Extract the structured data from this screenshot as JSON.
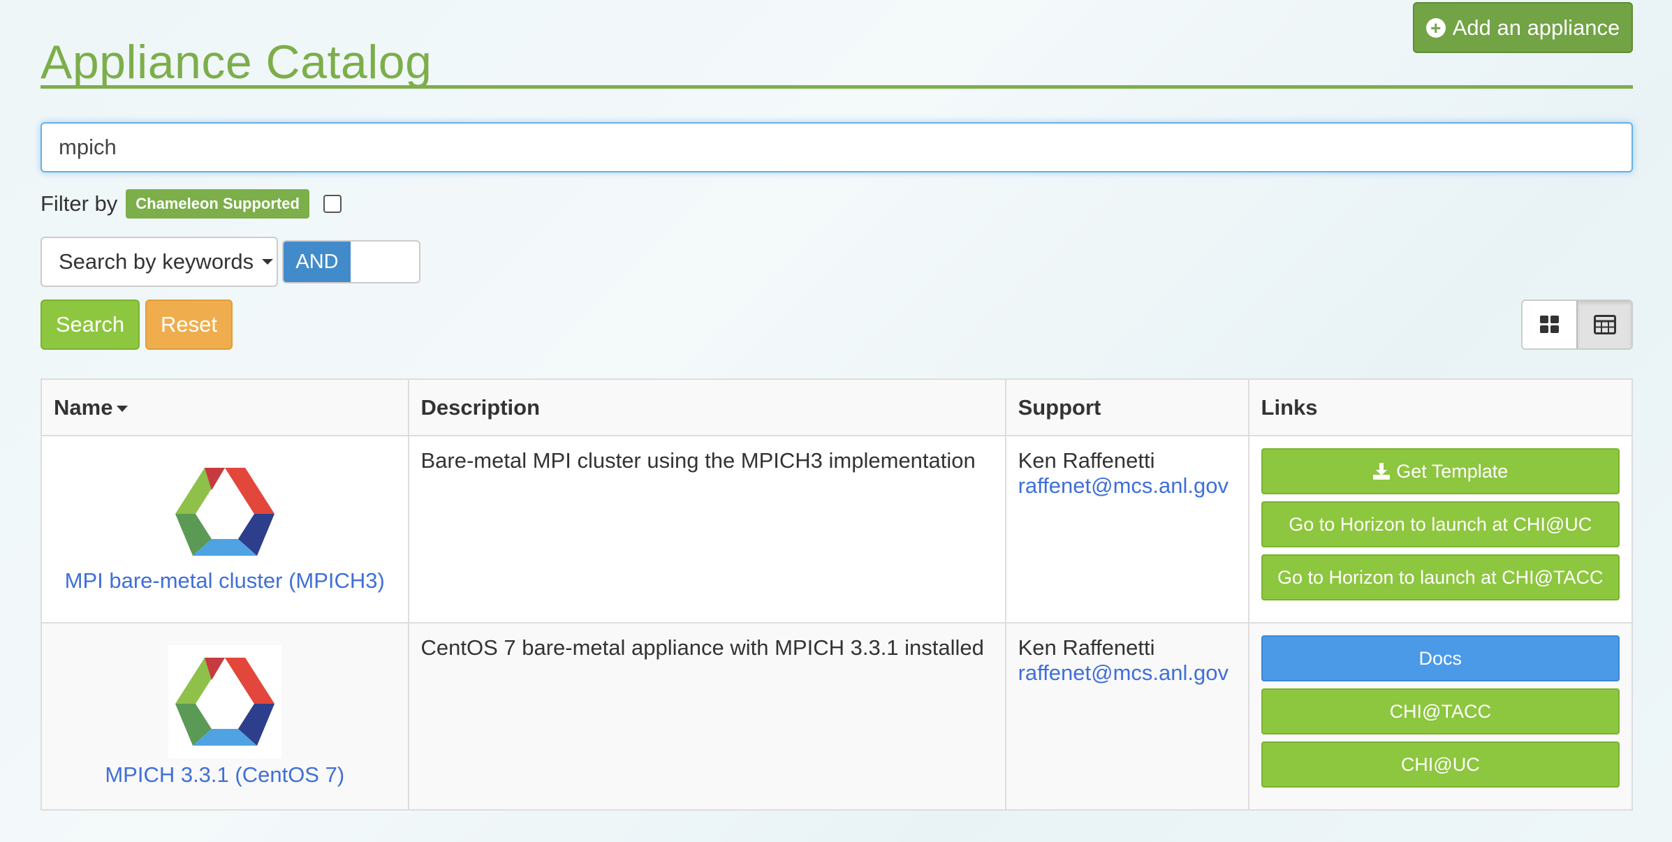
{
  "header": {
    "add_button_label": "Add an appliance",
    "title": "Appliance Catalog"
  },
  "search": {
    "value": "mpich"
  },
  "filter": {
    "label": "Filter by",
    "badge": "Chameleon Supported",
    "checked": false
  },
  "keywords": {
    "dropdown_label": "Search by keywords",
    "toggle_label": "AND"
  },
  "buttons": {
    "search": "Search",
    "reset": "Reset"
  },
  "view": {
    "options": [
      "grid-icon",
      "table-icon"
    ],
    "active": "table-icon"
  },
  "table": {
    "columns": [
      "Name",
      "Description",
      "Support",
      "Links"
    ],
    "rows": [
      {
        "name": "MPI bare-metal cluster (MPICH3)",
        "description": "Bare-metal MPI cluster using the MPICH3 implementation",
        "support_name": "Ken Raffenetti",
        "support_email": "raffenet@mcs.anl.gov",
        "links": [
          "Get Template",
          "Go to Horizon to launch at CHI@UC",
          "Go to Horizon to launch at CHI@TACC"
        ]
      },
      {
        "name": "MPICH 3.3.1 (CentOS 7)",
        "description": "CentOS 7 bare-metal appliance with MPICH 3.3.1 installed",
        "support_name": "Ken Raffenetti",
        "support_email": "raffenet@mcs.anl.gov",
        "links": [
          "Docs",
          "CHI@TACC",
          "CHI@UC"
        ]
      }
    ]
  },
  "colors": {
    "brand_green": "#7cae4a",
    "button_green": "#8dc63f",
    "reset_orange": "#f0ad4e",
    "toggle_blue": "#428bca",
    "link_blue": "#3f6fd8",
    "docs_blue": "#4a9ae8"
  }
}
